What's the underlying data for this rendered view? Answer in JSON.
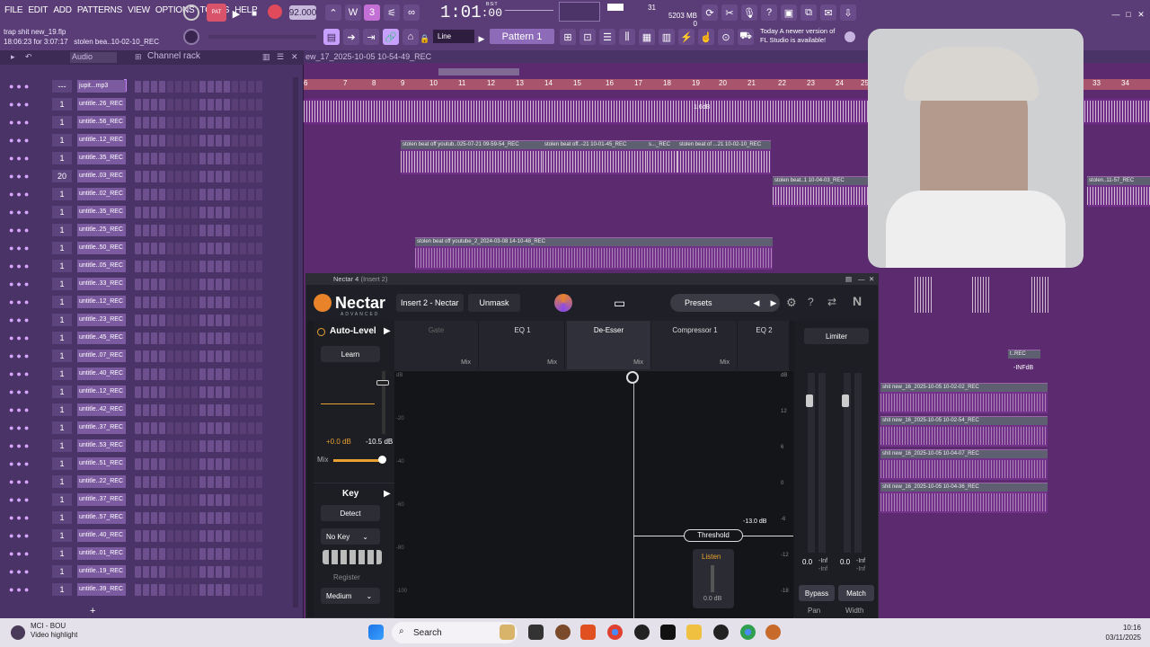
{
  "menu": [
    "FILE",
    "EDIT",
    "ADD",
    "PATTERNS",
    "VIEW",
    "OPTIONS",
    "TOOLS",
    "HELP"
  ],
  "project": {
    "title": "trap shit new_19.flp",
    "time": "18:06:23 for 3:07:17",
    "hint": "stolen bea..10-02-10_REC"
  },
  "transport": {
    "tempo": "92.000",
    "time": "1:01",
    "time_sub": ":00",
    "bst": "B:S:T",
    "mem": "5203 MB",
    "cpu": "31",
    "voices": "0"
  },
  "toolbar": {
    "line_mode": "Line",
    "pattern": "Pattern 1"
  },
  "news": {
    "line1": "Today  A newer version of",
    "line2": "FL Studio is available!"
  },
  "channel_rack": {
    "title": "Channel rack",
    "filter": "Audio",
    "rows": [
      {
        "num": "---",
        "name": "jupit...mp3"
      },
      {
        "num": "1",
        "name": "untitle..26_REC"
      },
      {
        "num": "1",
        "name": "untitle..56_REC"
      },
      {
        "num": "1",
        "name": "untitle..12_REC"
      },
      {
        "num": "1",
        "name": "untitle..35_REC"
      },
      {
        "num": "20",
        "name": "untitle..03_REC"
      },
      {
        "num": "1",
        "name": "untitle..02_REC"
      },
      {
        "num": "1",
        "name": "untitle..35_REC"
      },
      {
        "num": "1",
        "name": "untitle..25_REC"
      },
      {
        "num": "1",
        "name": "untitle..50_REC"
      },
      {
        "num": "1",
        "name": "untitle..05_REC"
      },
      {
        "num": "1",
        "name": "untitle..33_REC"
      },
      {
        "num": "1",
        "name": "untitle..12_REC"
      },
      {
        "num": "1",
        "name": "untitle..23_REC"
      },
      {
        "num": "1",
        "name": "untitle..45_REC"
      },
      {
        "num": "1",
        "name": "untitle..07_REC"
      },
      {
        "num": "1",
        "name": "untitle..40_REC"
      },
      {
        "num": "1",
        "name": "untitle..12_REC"
      },
      {
        "num": "1",
        "name": "untitle..42_REC"
      },
      {
        "num": "1",
        "name": "untitle..37_REC"
      },
      {
        "num": "1",
        "name": "untitle..53_REC"
      },
      {
        "num": "1",
        "name": "untitle..51_REC"
      },
      {
        "num": "1",
        "name": "untitle..22_REC"
      },
      {
        "num": "1",
        "name": "untitle..37_REC"
      },
      {
        "num": "1",
        "name": "untitle..57_REC"
      },
      {
        "num": "1",
        "name": "untitle..40_REC"
      },
      {
        "num": "1",
        "name": "untitle..01_REC"
      },
      {
        "num": "1",
        "name": "untitle..19_REC"
      },
      {
        "num": "1",
        "name": "untitle..39_REC"
      }
    ]
  },
  "playlist": {
    "title": "ew_17_2025-10-05 10-54-49_REC",
    "ruler": [
      "6",
      "7",
      "8",
      "9",
      "10",
      "11",
      "12",
      "13",
      "14",
      "15",
      "16",
      "17",
      "18",
      "19",
      "20",
      "21",
      "22",
      "23",
      "24",
      "25",
      "33",
      "34"
    ],
    "clips": {
      "c1": "stolen beat off youtub..025-07-21 09-59-54_REC",
      "c2": "stolen beat off..-21 10-01-45_REC",
      "c3": "s..._REC",
      "c4": "stolen beat of ...21 10-02-10_REC",
      "c5": "stolen beat..1 10-04-03_REC",
      "c6": "stolen..11-57_REC",
      "c7": "stolen beat off youtube_2_2024-03-08 14-10-48_REC",
      "c8": "shit new_16_2025-10-05 10-02-02_REC",
      "c9": "shit new_16_2025-10-05 10-02-54_REC",
      "c10": "shit new_16_2025-10-05 10-04-07_REC",
      "c11": "shit new_16_2025-10-05 10-04-36_REC",
      "c12": "t..REC",
      "c13": "-INFdB",
      "gain": "1.6dB"
    }
  },
  "nectar": {
    "window_title": "Nectar 4",
    "window_sub": "(Insert 2)",
    "logo": "Nectar",
    "logo_sub": "ADVANCED",
    "insert": "Insert 2 - Nectar",
    "unmask": "Unmask",
    "presets": "Presets",
    "modules": [
      "Gate",
      "EQ 1",
      "De-Esser",
      "Compressor 1",
      "EQ 2"
    ],
    "mix": "Mix",
    "autolevel": {
      "title": "Auto-Level",
      "learn": "Learn",
      "gain": "+0.0 dB",
      "level": "-10.5 dB",
      "mix": "Mix"
    },
    "key": {
      "title": "Key",
      "detect": "Detect",
      "key_value": "No Key",
      "register_label": "Register",
      "register": "Medium"
    },
    "graph": {
      "scale": [
        "dB",
        "-20",
        "-40",
        "-60",
        "-80",
        "-100"
      ],
      "right_scale": [
        "dB",
        "12",
        "6",
        "0",
        "-6",
        "-12",
        "-18",
        "-24"
      ],
      "threshold": "Threshold",
      "threshold_db": "-13.0 dB",
      "listen": "Listen",
      "listen_db": "0.0 dB"
    },
    "limiter": {
      "title": "Limiter",
      "l1": "0.0",
      "l2": "-Inf",
      "l3": "-Inf",
      "r1": "0.0",
      "r2": "-Inf",
      "r3": "-Inf",
      "bypass": "Bypass",
      "match": "Match",
      "pan": "Pan",
      "width": "Width"
    }
  },
  "taskbar": {
    "media_title": "MCI - BOU",
    "media_sub": "Video highlight",
    "search": "Search",
    "time": "10:16",
    "date": "03/11/2025"
  }
}
